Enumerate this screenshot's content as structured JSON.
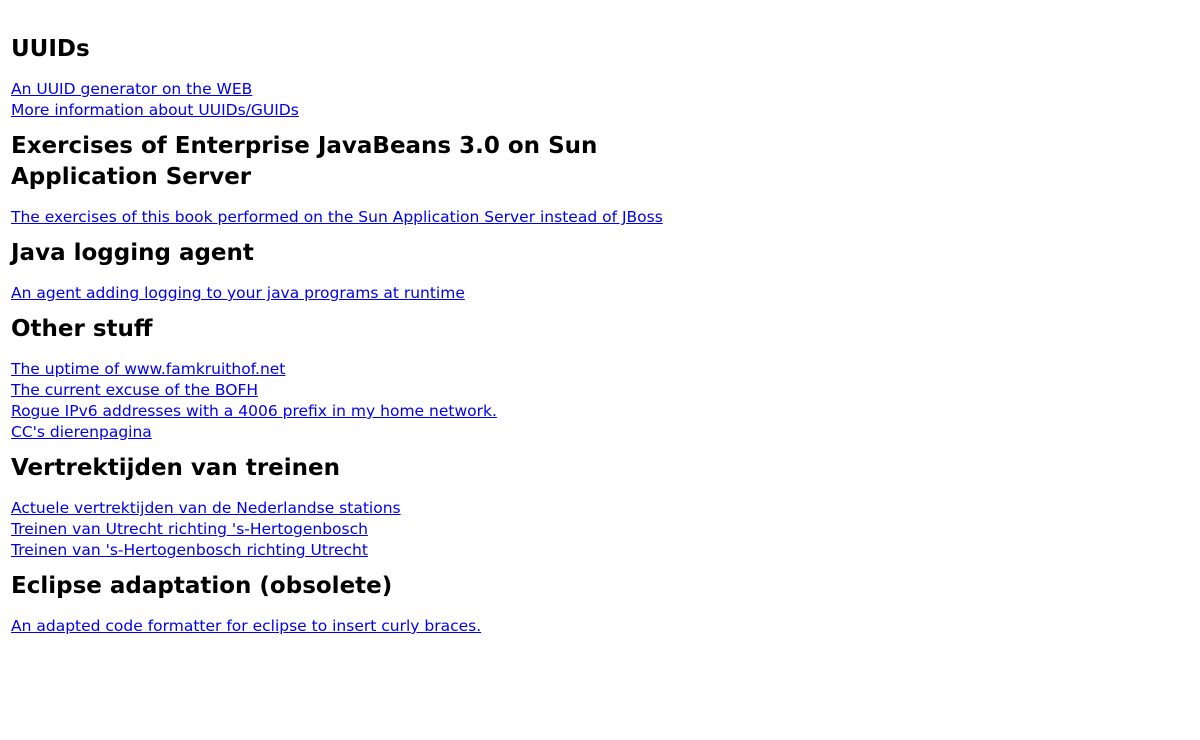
{
  "sections": [
    {
      "title": "UUIDs",
      "links": [
        "An UUID generator on the WEB",
        "More information about UUIDs/GUIDs"
      ]
    },
    {
      "title": "Exercises of Enterprise JavaBeans 3.0 on Sun Application Server",
      "links": [
        "The exercises of this book performed on the Sun Application Server instead of JBoss"
      ]
    },
    {
      "title": "Java logging agent",
      "links": [
        "An agent adding logging to your java programs at runtime"
      ]
    },
    {
      "title": "Other stuff",
      "links": [
        "The uptime of www.famkruithof.net",
        "The current excuse of the BOFH",
        "Rogue IPv6 addresses with a 4006 prefix in my home network.",
        "CC's dierenpagina"
      ]
    },
    {
      "title": "Vertrektijden van treinen",
      "links": [
        "Actuele vertrektijden van de Nederlandse stations",
        "Treinen van Utrecht richting 's-Hertogenbosch",
        "Treinen van 's-Hertogenbosch richting Utrecht"
      ]
    },
    {
      "title": "Eclipse adaptation (obsolete)",
      "links": [
        "An adapted code formatter for eclipse to insert curly braces."
      ]
    }
  ],
  "colors": {
    "link": "#0000ee",
    "heading": "#000000",
    "background": "#ffffff"
  }
}
